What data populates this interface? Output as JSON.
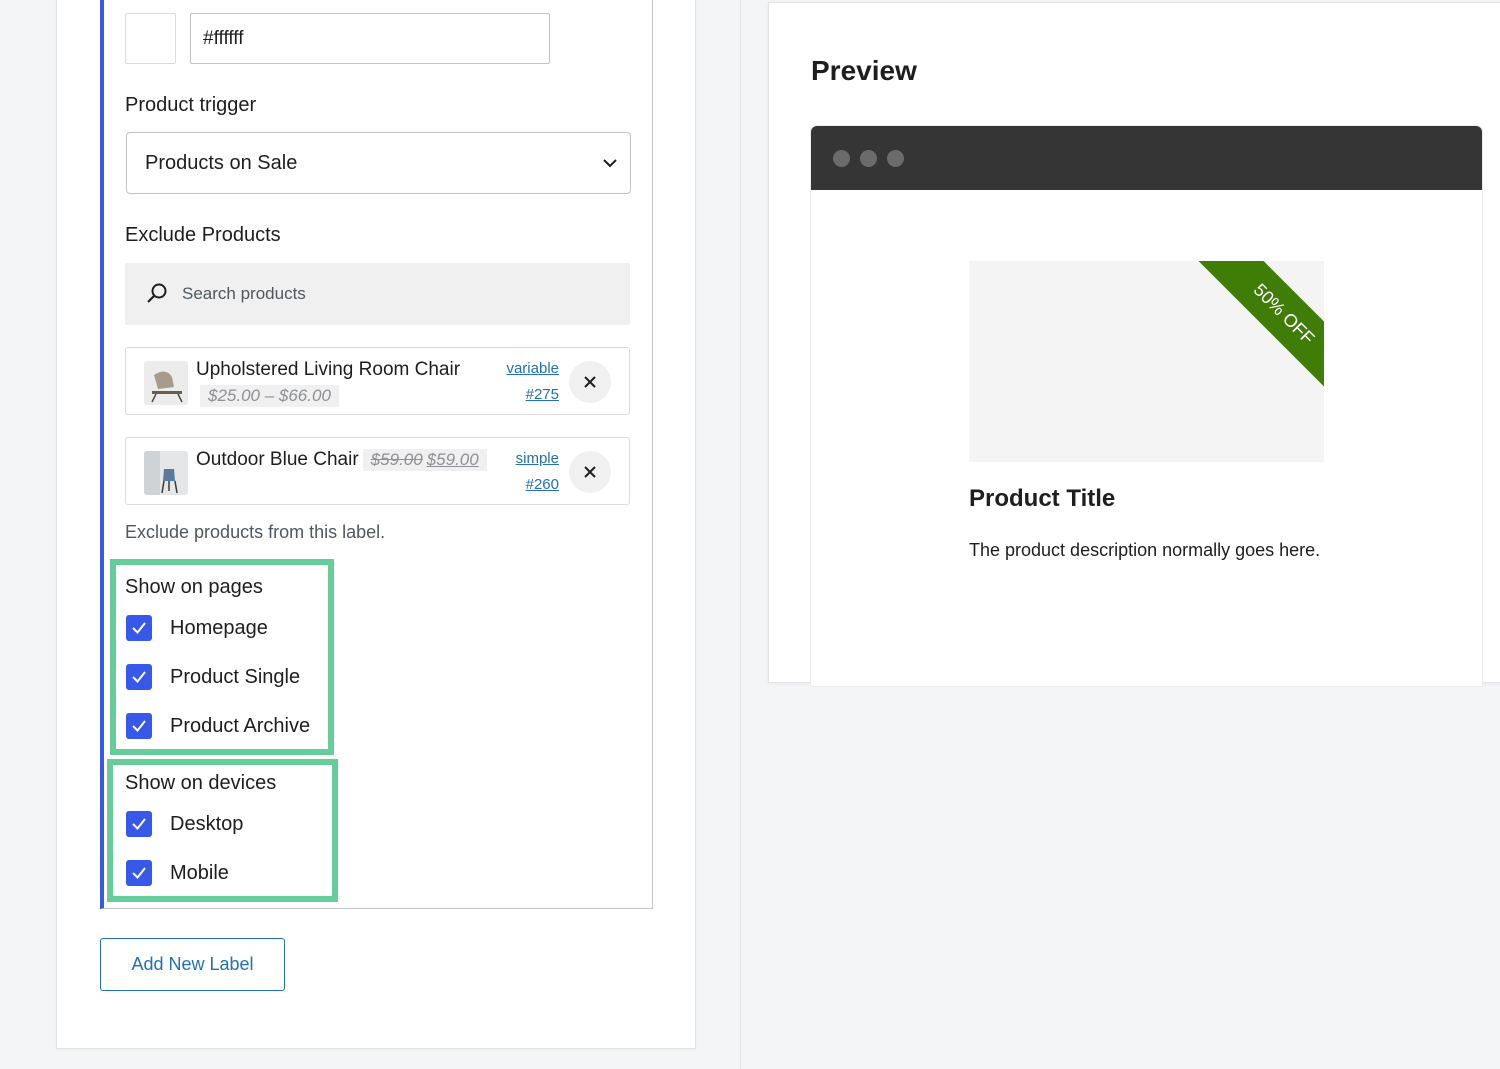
{
  "color": {
    "hex_value": "#ffffff",
    "swatch_color": "#ffffff"
  },
  "trigger": {
    "label": "Product trigger",
    "selected": "Products on Sale"
  },
  "exclude": {
    "label": "Exclude Products",
    "search_placeholder": "Search products",
    "help": "Exclude products from this label.",
    "items": [
      {
        "name": "Upholstered Living Room Chair",
        "price": "$25.00 – $66.00",
        "type": "variable",
        "id": "#275"
      },
      {
        "name": "Outdoor Blue Chair",
        "old_price": "$59.00",
        "new_price": "$59.00",
        "type": "simple",
        "id": "#260"
      }
    ]
  },
  "pages": {
    "title": "Show on pages",
    "options": [
      "Homepage",
      "Product Single",
      "Product Archive"
    ]
  },
  "devices": {
    "title": "Show on devices",
    "options": [
      "Desktop",
      "Mobile"
    ]
  },
  "add_button": "Add New Label",
  "preview": {
    "title": "Preview",
    "badge": "50% OFF",
    "product_title": "Product Title",
    "product_desc": "The product description normally goes here."
  },
  "colors": {
    "accent": "#3858e9",
    "link": "#2271b1",
    "highlight": "#66cc99",
    "ribbon": "#3f7d06"
  }
}
